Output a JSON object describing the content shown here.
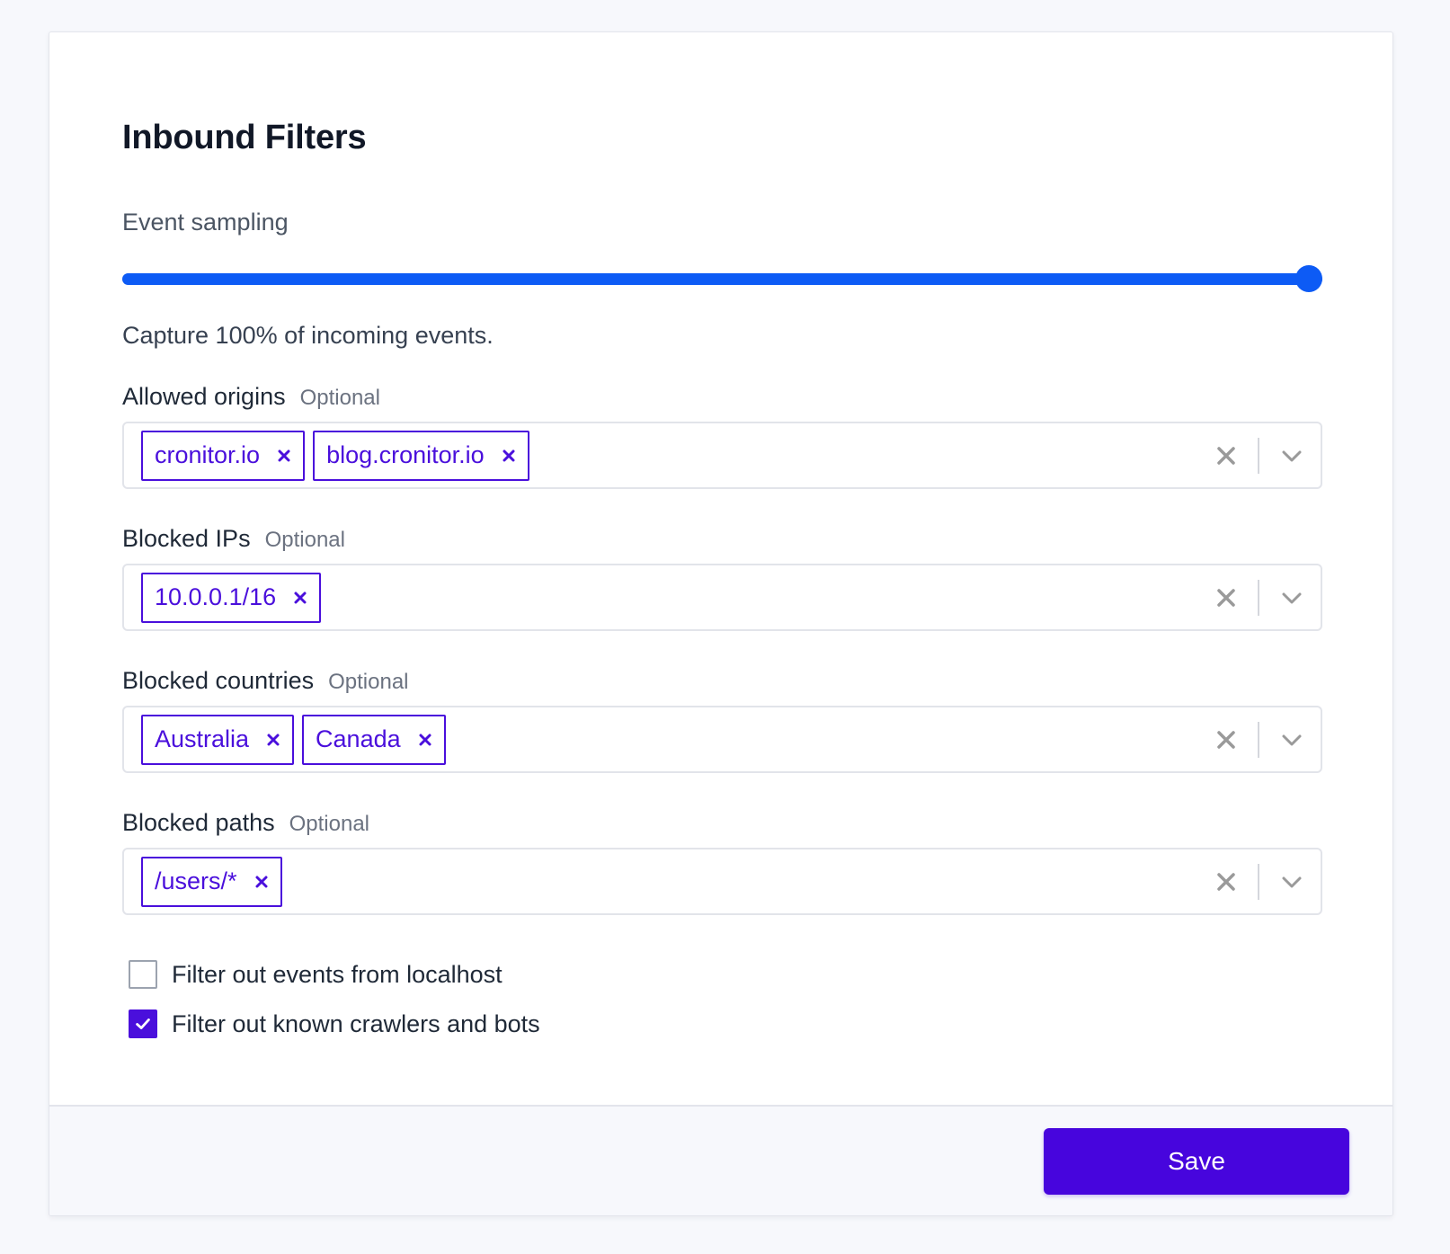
{
  "title": "Inbound Filters",
  "sampling": {
    "label": "Event sampling",
    "value_percent": 100,
    "description": "Capture 100% of incoming events."
  },
  "fields": {
    "allowed_origins": {
      "label": "Allowed origins",
      "optional": "Optional",
      "tags": [
        "cronitor.io",
        "blog.cronitor.io"
      ]
    },
    "blocked_ips": {
      "label": "Blocked IPs",
      "optional": "Optional",
      "tags": [
        "10.0.0.1/16"
      ]
    },
    "blocked_countries": {
      "label": "Blocked countries",
      "optional": "Optional",
      "tags": [
        "Australia",
        "Canada"
      ]
    },
    "blocked_paths": {
      "label": "Blocked paths",
      "optional": "Optional",
      "tags": [
        "/users/*"
      ]
    }
  },
  "checkboxes": {
    "localhost": {
      "label": "Filter out events from localhost",
      "checked": false
    },
    "bots": {
      "label": "Filter out known crawlers and bots",
      "checked": true
    }
  },
  "footer": {
    "save_label": "Save"
  },
  "colors": {
    "accent": "#4a0fdc",
    "slider": "#0d5bf5",
    "save_button": "#4705dd"
  },
  "icons": {
    "tag_remove": "close-icon",
    "clear": "clear-icon",
    "dropdown": "chevron-down-icon",
    "check": "check-icon"
  }
}
